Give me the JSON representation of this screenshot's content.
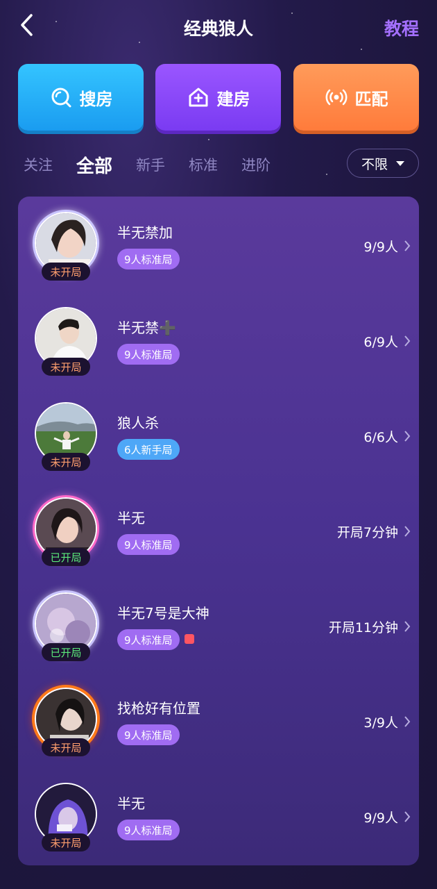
{
  "header": {
    "title": "经典狼人",
    "tutorial_label": "教程"
  },
  "actions": {
    "search_label": "搜房",
    "build_label": "建房",
    "match_label": "匹配"
  },
  "tabs": [
    "关注",
    "全部",
    "新手",
    "标准",
    "进阶"
  ],
  "active_tab": "全部",
  "filter": {
    "label": "不限"
  },
  "rooms": [
    {
      "name": "半无禁加",
      "tag": "9人标准局",
      "tag_type": "standard",
      "status": "未开局",
      "count": "9/9人"
    },
    {
      "name": "半无禁➕",
      "tag": "9人标准局",
      "tag_type": "standard",
      "status": "未开局",
      "count": "6/9人"
    },
    {
      "name": "狼人杀",
      "tag": "6人新手局",
      "tag_type": "newbie",
      "status": "未开局",
      "count": "6/6人"
    },
    {
      "name": "半无",
      "tag": "9人标准局",
      "tag_type": "standard",
      "status": "已开局",
      "count": "开局7分钟"
    },
    {
      "name": "半无7号是大神",
      "tag": "9人标准局",
      "tag_type": "standard",
      "status": "已开局",
      "count": "开局11分钟"
    },
    {
      "name": "找枪好有位置",
      "tag": "9人标准局",
      "tag_type": "standard",
      "status": "未开局",
      "count": "3/9人"
    },
    {
      "name": "半无",
      "tag": "9人标准局",
      "tag_type": "standard",
      "status": "未开局",
      "count": "9/9人"
    }
  ],
  "colors": {
    "accent": "#a470ff",
    "search_button": "#1a9cf0",
    "build_button": "#7a3bf2",
    "match_button": "#ff7b3b",
    "status_not_started": "#ff9f6e",
    "status_started": "#5bea7a"
  }
}
